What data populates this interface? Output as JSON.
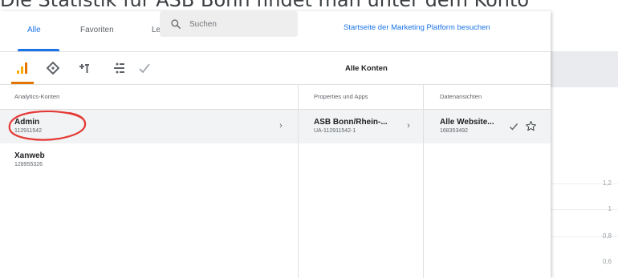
{
  "background": {
    "heading": "Die Statistik für ASB Bonn findet man unter dem Konto",
    "axis_ticks": [
      "1,2",
      "1",
      "0,8",
      "0,6"
    ]
  },
  "tabs": [
    {
      "label": "Alle",
      "active": true
    },
    {
      "label": "Favoriten",
      "active": false
    },
    {
      "label": "Le",
      "active": false
    }
  ],
  "search": {
    "placeholder": "Suchen"
  },
  "marketing_link": "Startseite der Marketing Platform besuchen",
  "product_icons": [
    "analytics-bar-icon",
    "tag-manager-icon",
    "optimize-icon",
    "data-studio-icon",
    "surveys-check-icon"
  ],
  "section_title": "Alle Konten",
  "columns": {
    "accounts": {
      "header": "Analytics-Konten",
      "items": [
        {
          "name": "Admin",
          "id": "112911542",
          "selected": true
        },
        {
          "name": "Xanweb",
          "id": "128955326",
          "selected": false
        }
      ]
    },
    "properties": {
      "header": "Properties und Apps",
      "items": [
        {
          "name": "ASB Bonn/Rhein-...",
          "id": "UA-112911542-1",
          "selected": true
        }
      ]
    },
    "views": {
      "header": "Datenansichten",
      "items": [
        {
          "name": "Alle Website...",
          "id": "168353492",
          "selected": true
        }
      ]
    }
  },
  "colors": {
    "accent": "#1a73e8",
    "analytics_orange": "#f9ab00",
    "annotation_red": "#e53935"
  }
}
